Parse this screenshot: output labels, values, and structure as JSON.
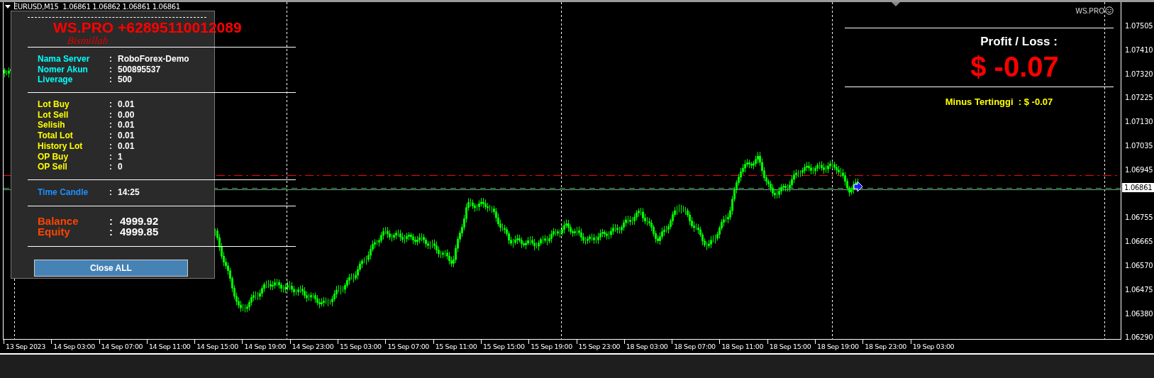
{
  "chart_header": {
    "text": "EURUSD,M15  1.06861 1.06862 1.06861 1.06861"
  },
  "indicator_label": {
    "text": "WS.PRO"
  },
  "info_panel": {
    "title": "WS.PRO +62895110012089",
    "subtitle": "Bismillah",
    "sections": [
      {
        "kind": "account",
        "rows": [
          {
            "label": "Nama Server",
            "separator": ":",
            "value": "RoboForex-Demo"
          },
          {
            "label": "Nomer Akun",
            "separator": ":",
            "value": "500895537"
          },
          {
            "label": "Liverage",
            "separator": ":",
            "value": "500"
          }
        ]
      },
      {
        "kind": "lots",
        "rows": [
          {
            "label": "Lot Buy",
            "separator": ":",
            "value": "0.01"
          },
          {
            "label": "Lot Sell",
            "separator": ":",
            "value": "0.00"
          },
          {
            "label": "Selisih",
            "separator": ":",
            "value": "0.01"
          },
          {
            "label": "Total Lot",
            "separator": ":",
            "value": "0.01"
          },
          {
            "label": "History Lot",
            "separator": ":",
            "value": "0.01"
          },
          {
            "label": "OP Buy",
            "separator": ":",
            "value": "1"
          },
          {
            "label": "OP Sell",
            "separator": ":",
            "value": "0"
          }
        ]
      },
      {
        "kind": "time",
        "rows": [
          {
            "label": "Time Candle",
            "separator": ":",
            "value": "14:25"
          }
        ]
      },
      {
        "kind": "money",
        "rows": [
          {
            "label": "Balance",
            "separator": ":",
            "value": "4999.92"
          },
          {
            "label": "Equity",
            "separator": ":",
            "value": "4999.85"
          }
        ]
      }
    ],
    "button": "Close ALL"
  },
  "profit_panel": {
    "title": "Profit / Loss :",
    "amount": "$ -0.07",
    "max_loss": "Minus Tertinggi  : $ -0.07"
  },
  "price_axis": {
    "labels": [
      "1.07505",
      "1.07410",
      "1.07320",
      "1.07225",
      "1.07130",
      "1.07035",
      "1.06945",
      "1.06755",
      "1.06665",
      "1.06570",
      "1.06475",
      "1.06380",
      "1.06290"
    ],
    "current_price": "1.06861"
  },
  "time_axis": {
    "labels": [
      "13 Sep 2023",
      "14 Sep 03:00",
      "14 Sep 07:00",
      "14 Sep 11:00",
      "14 Sep 15:00",
      "14 Sep 19:00",
      "14 Sep 23:00",
      "15 Sep 03:00",
      "15 Sep 07:00",
      "15 Sep 11:00",
      "15 Sep 15:00",
      "15 Sep 19:00",
      "15 Sep 23:00",
      "18 Sep 03:00",
      "18 Sep 07:00",
      "18 Sep 11:00",
      "18 Sep 15:00",
      "18 Sep 19:00",
      "18 Sep 23:00",
      "19 Sep 03:00"
    ]
  }
}
